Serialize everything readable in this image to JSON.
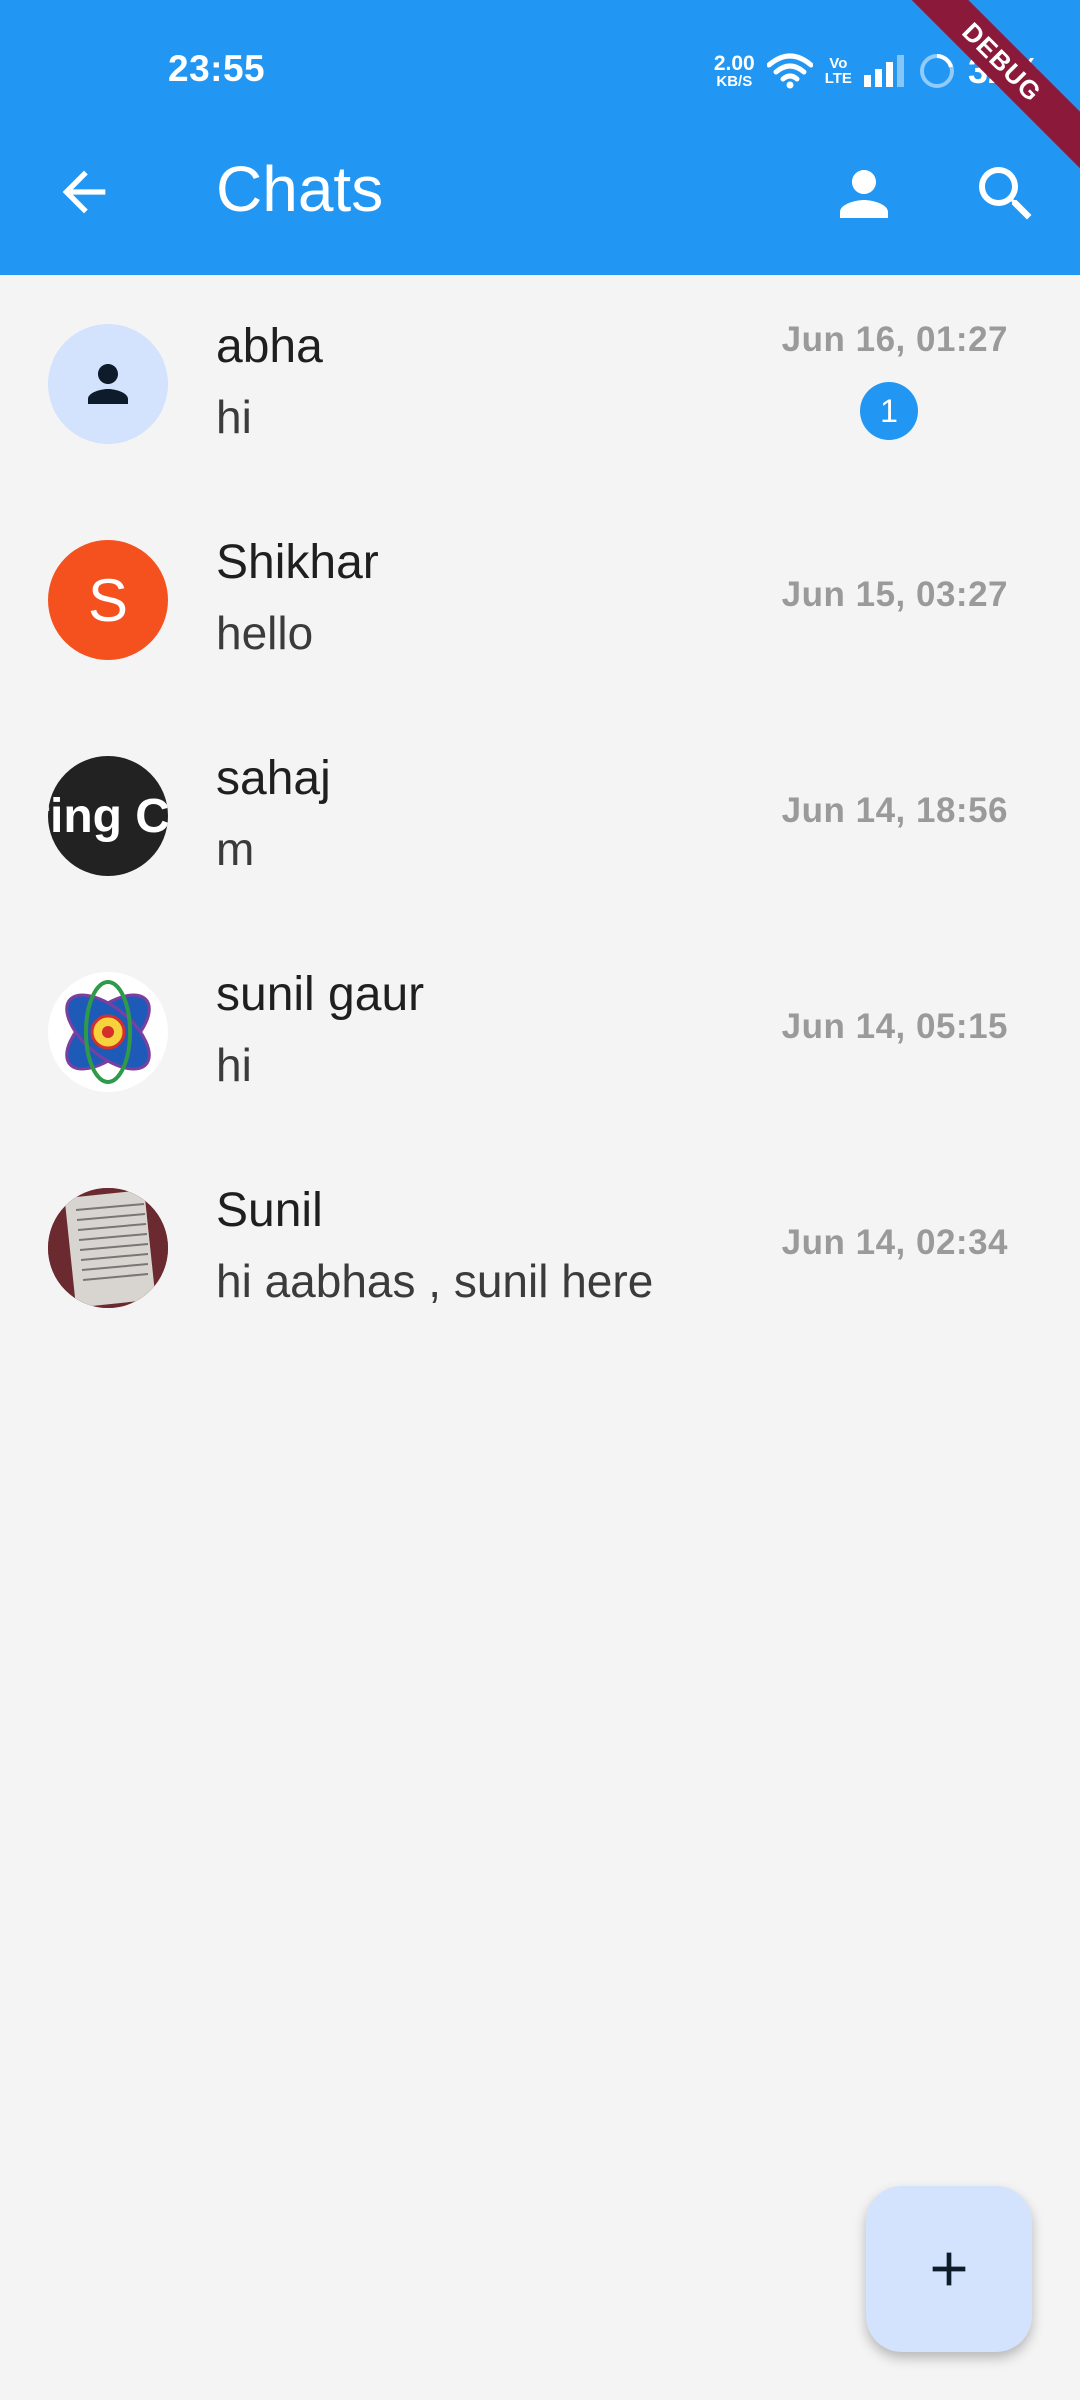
{
  "status_bar": {
    "time": "23:55",
    "net_speed_value": "2.00",
    "net_speed_unit": "KB/S",
    "volte_top": "Vo",
    "volte_bottom": "LTE",
    "battery": "32%",
    "icons": [
      "wifi-icon",
      "signal-icon",
      "battery-saver-icon"
    ]
  },
  "debug_banner": "DEBUG",
  "app_bar": {
    "title": "Chats",
    "back_icon": "arrow-back-icon",
    "profile_icon": "person-icon",
    "search_icon": "search-icon",
    "background_color": "#2196f3"
  },
  "chats": [
    {
      "name": "abha",
      "message": "hi",
      "time": "Jun 16, 01:27",
      "unread": "1",
      "avatar": "person-icon"
    },
    {
      "name": "Shikhar",
      "message": "hello",
      "time": "Jun 15, 03:27",
      "avatar_letter": "S",
      "avatar_color": "#f4511e"
    },
    {
      "name": "sahaj",
      "message": "m",
      "time": "Jun 14, 18:56",
      "avatar_text": "ting C"
    },
    {
      "name": "sunil gaur",
      "message": "hi",
      "time": "Jun 14, 05:15",
      "avatar": "apollo-logo"
    },
    {
      "name": "Sunil",
      "message": "hi aabhas , sunil here",
      "time": "Jun 14, 02:34",
      "avatar": "document-photo"
    }
  ],
  "fab": {
    "icon": "plus-icon",
    "color": "#d3e3fd"
  }
}
